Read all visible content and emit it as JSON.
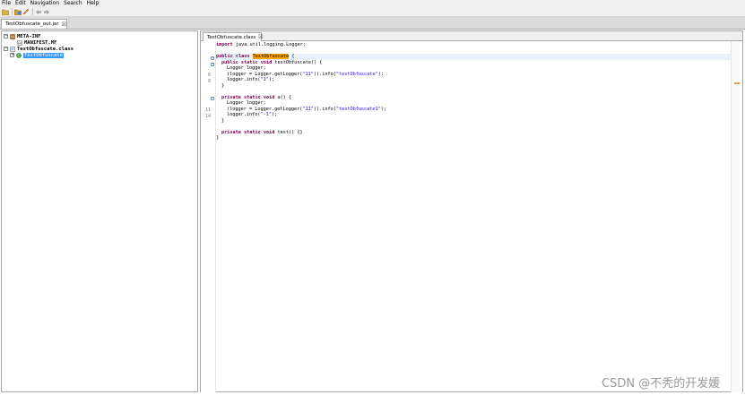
{
  "menu": [
    "File",
    "Edit",
    "Navigation",
    "Search",
    "Help"
  ],
  "file_tab": {
    "label": "TestObfuscate_out.jar",
    "close": "☒"
  },
  "tree": [
    {
      "label": "META-INF",
      "toggle": "⊟",
      "icon": "package-icon"
    },
    {
      "label": "MANIFEST.MF",
      "toggle": "",
      "icon": "manifest-file-icon"
    },
    {
      "label": "TestObfuscate.class",
      "toggle": "⊟",
      "icon": "class-file-icon"
    },
    {
      "label": "TestObfuscate",
      "toggle": "⊞",
      "icon": "class-icon",
      "selected": true
    }
  ],
  "editor_tab": {
    "label": "TestObfuscate.class",
    "close": "☒"
  },
  "code": {
    "l1": {
      "kw": "import",
      "rest": " java.util.logging.Logger;"
    },
    "l3": {
      "kw": "public class",
      "name": "TestObfuscate",
      "rest": " {"
    },
    "l4": {
      "kw": "public static void",
      "rest": " testObfuscate() {"
    },
    "l5": "Logger logger;",
    "l6": {
      "a": "(logger = Logger.getLogger(",
      "s1": "\"11\"",
      "b": ")).info(",
      "s2": "\"testObfuscate\"",
      "c": ");"
    },
    "l7": {
      "a": "logger.info(",
      "s": "\"1\"",
      "b": ");"
    },
    "l8": "}",
    "l10": {
      "kw": "private static void",
      "rest": " a() {"
    },
    "l11": "Logger logger;",
    "l12": {
      "a": "(logger = Logger.getLogger(",
      "s1": "\"11\"",
      "b": ")).info(",
      "s2": "\"testObfuscate1\"",
      "c": ");"
    },
    "l13": {
      "a": "logger.info(",
      "s": "\"-1\"",
      "b": ");"
    },
    "l14": "}",
    "l16": {
      "kw": "private static void",
      "rest": " test() {}"
    },
    "l17": "}"
  },
  "line_numbers": {
    "n6": "6",
    "n7": "8",
    "n12": "11",
    "n13": "14"
  },
  "watermark": "CSDN @不秃的开发媛",
  "colors": {
    "keyword": "#7f0055",
    "string": "#2a00ff",
    "highlight": "#ffa500",
    "selection": "#3399ff"
  }
}
